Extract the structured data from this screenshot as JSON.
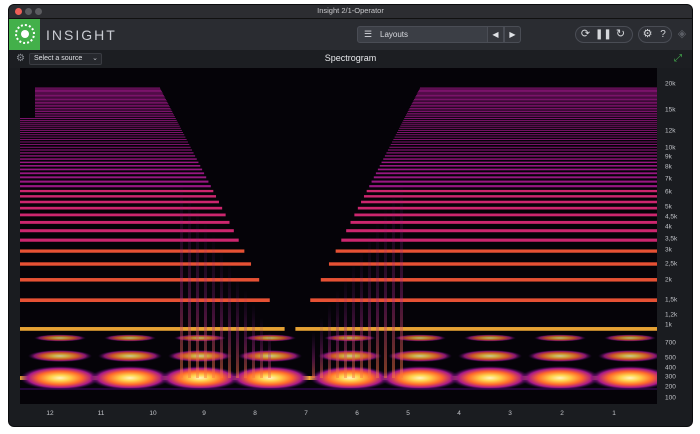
{
  "window": {
    "title": "Insight 2/1-Operator"
  },
  "toolbar": {
    "app_name": "INSIGHT",
    "layouts_label": "Layouts",
    "layouts_icon": "list-icon",
    "prev_icon": "triangle-left-icon",
    "next_icon": "triangle-right-icon",
    "icons": [
      "loop-icon",
      "pause-icon",
      "reset-icon",
      "settings-gear-icon",
      "help-icon",
      "fullscreen-icon"
    ],
    "accent_color": "#43b04a"
  },
  "panel": {
    "title": "Spectrogram",
    "source_label": "Select a source",
    "settings_icon": "gear-icon",
    "expand_icon": "expand-icon"
  },
  "chart_data": {
    "type": "heatmap",
    "title": "Spectrogram",
    "y_ticks": [
      "20k",
      "15k",
      "12k",
      "10k",
      "9k",
      "8k",
      "7k",
      "6k",
      "5k",
      "4,5k",
      "4k",
      "3,5k",
      "3k",
      "2,5k",
      "2k",
      "1,5k",
      "1,2k",
      "1k",
      "700",
      "500",
      "400",
      "300",
      "200",
      "100"
    ],
    "x_ticks": [
      "12",
      "11",
      "10",
      "9",
      "8",
      "7",
      "6",
      "5",
      "4",
      "3",
      "2",
      "1"
    ],
    "colormap": [
      "#050308",
      "#3a0a5e",
      "#8a1a9a",
      "#d8247a",
      "#ff6a2a",
      "#ffd24a",
      "#fff6c0"
    ]
  }
}
